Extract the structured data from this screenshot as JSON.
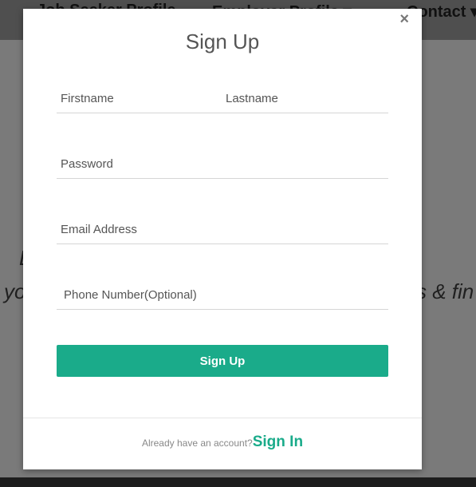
{
  "background": {
    "nav_fragments": [
      "Job Seeker Profile",
      "Employer Profile ▾",
      "Contact ▾"
    ],
    "hero_fragments": [
      "E",
      "yo",
      "s & fin"
    ]
  },
  "modal": {
    "close_label": "×",
    "title": "Sign Up",
    "fields": {
      "firstname_placeholder": "Firstname",
      "lastname_placeholder": "Lastname",
      "password_placeholder": "Password",
      "email_placeholder": "Email Address",
      "phone_placeholder": "Phone Number(Optional)"
    },
    "submit_label": "Sign Up",
    "footer": {
      "prompt": "Already have an account?",
      "link": "Sign In"
    }
  },
  "colors": {
    "accent": "#1aab8a",
    "overlay": "#7a7a7a"
  }
}
